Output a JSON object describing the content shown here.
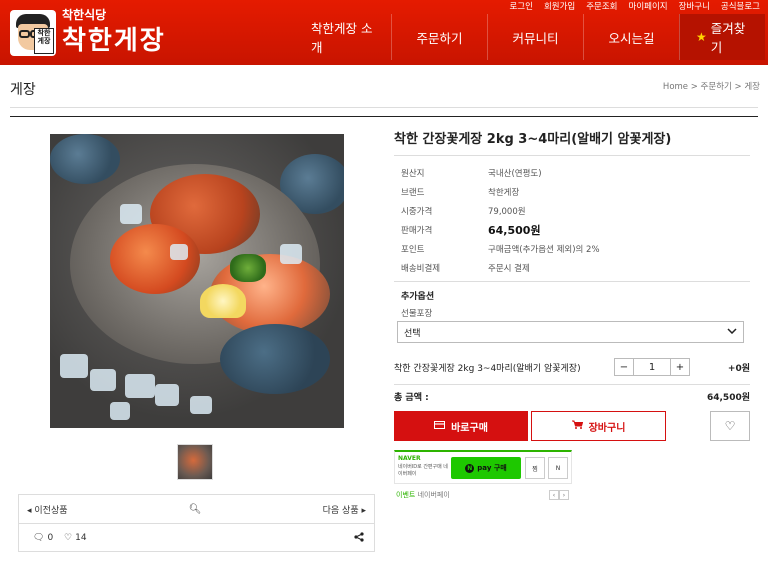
{
  "colors": {
    "brand_red": "#e51b00",
    "buy_red": "#d51010",
    "naver_green": "#1ec800"
  },
  "header": {
    "logo_small": "착한식당",
    "logo_big": "착한게장",
    "logo_sign": "착한\n게장",
    "top_links": [
      "로그인",
      "회원가입",
      "주문조회",
      "마이페이지",
      "장바구니",
      "공식블로그"
    ],
    "nav": [
      "착한게장 소개",
      "주문하기",
      "커뮤니티",
      "오시는길"
    ],
    "favorite_label": "즐겨찾기",
    "favorite_icon": "star-icon"
  },
  "page": {
    "section_title": "게장",
    "breadcrumb": "Home > 주문하기 > 게장"
  },
  "gallery": {
    "prev_label": "이전상품",
    "next_label": "다음 상품",
    "zoom_icon": "zoom-icon",
    "comment_count": "0",
    "like_count": "14"
  },
  "product": {
    "title": "착한 간장꽃게장 2kg 3~4마리(알배기 암꽃게장)",
    "info": [
      {
        "key": "원산지",
        "value": "국내산(연평도)"
      },
      {
        "key": "브랜드",
        "value": "착한게장"
      },
      {
        "key": "시중가격",
        "value": "79,000원"
      },
      {
        "key": "판매가격",
        "value": "64,500원"
      },
      {
        "key": "포인트",
        "value": "구매금액(추가옵션 제외)의 2%"
      },
      {
        "key": "배송비결제",
        "value": "주문시 결제"
      }
    ]
  },
  "options": {
    "title": "추가옵션",
    "label": "선물포장",
    "selected": "선택"
  },
  "quantity": {
    "name": "착한 간장꽃게장 2kg 3~4마리(알배기 암꽃게장)",
    "minus": "−",
    "value": "1",
    "plus": "+",
    "price": "+0원"
  },
  "total": {
    "label": "총 금액 :",
    "value": "64,500원"
  },
  "buttons": {
    "buy": "바로구매",
    "cart": "장바구니"
  },
  "npay": {
    "brand": "NAVER",
    "desc": "네이버ID로 간편구매 네이버페이",
    "pay_label": "pay 구매",
    "jjim": "찜",
    "np": "N",
    "event_label": "이벤트",
    "event_text": "네이버페이",
    "prev": "‹",
    "next": "›"
  }
}
